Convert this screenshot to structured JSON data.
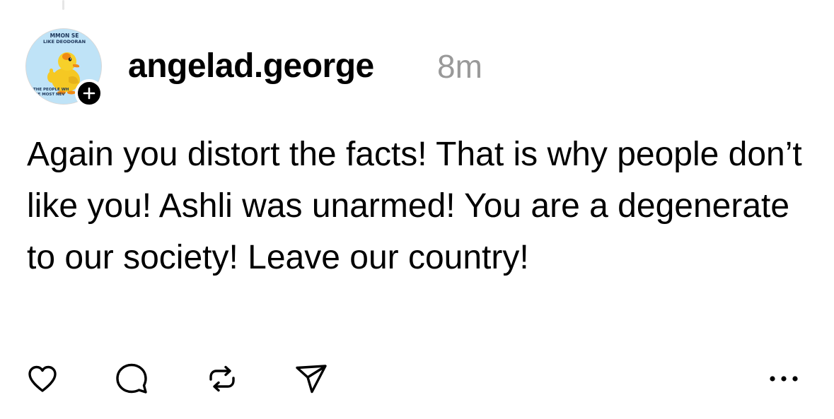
{
  "post": {
    "username": "angelad.george",
    "timestamp": "8m",
    "text": "Again you distort the facts! That is why people don’t like you! Ashli was unarmed! You are a degenerate to our society! Leave our country!",
    "avatar": {
      "icon": "duck-cartoon-avatar",
      "top_text_line1": "MMON SE",
      "top_text_line2": "LIKE DEODORAN",
      "bottom_text_line1": "THE PEOPLE WH",
      "bottom_text_line2": "HE MOST NEV"
    },
    "follow_badge": {
      "icon": "plus-icon",
      "color": "#000000"
    }
  },
  "actions": [
    {
      "name": "like-button",
      "icon": "heart-icon"
    },
    {
      "name": "reply-button",
      "icon": "comment-bubble-icon"
    },
    {
      "name": "repost-button",
      "icon": "repost-icon"
    },
    {
      "name": "share-button",
      "icon": "send-icon"
    },
    {
      "name": "more-button",
      "icon": "more-dots-icon"
    }
  ],
  "colors": {
    "text": "#000000",
    "muted": "#999999",
    "background": "#ffffff",
    "thread_line": "#e6e6e6"
  }
}
